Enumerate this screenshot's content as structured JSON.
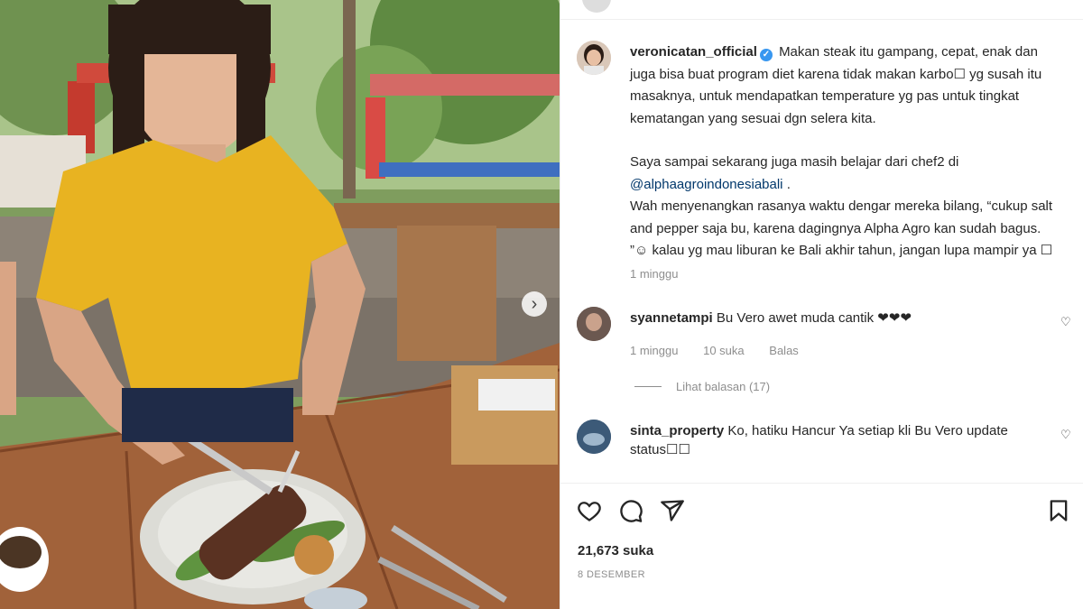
{
  "post": {
    "username": "veronicatan_official",
    "caption_lines": [
      "Makan steak itu gampang, cepat, enak dan juga bisa buat program diet karena tidak makan karbo☐ yg susah itu masaknya, untuk mendapatkan temperature yg pas untuk tingkat kematangan yang sesuai dgn selera kita."
    ],
    "caption_p2_prefix": "Saya sampai sekarang juga masih belajar dari chef2 di",
    "caption_mention": "@alphaagroindonesiabali",
    "caption_mention_suffix": " .",
    "caption_p3": "Wah menyenangkan rasanya waktu dengar mereka bilang, “cukup salt and pepper saja bu, karena dagingnya Alpha Agro kan sudah bagus. ”☺ kalau yg mau liburan ke Bali akhir tahun, jangan lupa mampir ya ☐",
    "time_ago": "1 minggu"
  },
  "comments": [
    {
      "username": "syannetampi",
      "text": "Bu Vero awet muda cantik ❤❤❤",
      "time_ago": "1 minggu",
      "likes": "10 suka",
      "reply_label": "Balas",
      "view_replies": "Lihat balasan (17)"
    },
    {
      "username": "sinta_property",
      "text": "Ko, hatiku Hancur Ya setiap kli Bu Vero update status☐☐"
    }
  ],
  "footer": {
    "likes": "21,673 suka",
    "date": "8 DESEMBER"
  },
  "icons": {
    "like": "heart-icon",
    "comment": "comment-bubble-icon",
    "share": "paper-plane-icon",
    "save": "bookmark-icon",
    "verified": "verified-badge-icon",
    "next": "chevron-right-icon"
  },
  "colors": {
    "verified": "#3897f0",
    "mention": "#00376b",
    "muted": "#8e8e8e",
    "shirt": "#e8b321"
  }
}
